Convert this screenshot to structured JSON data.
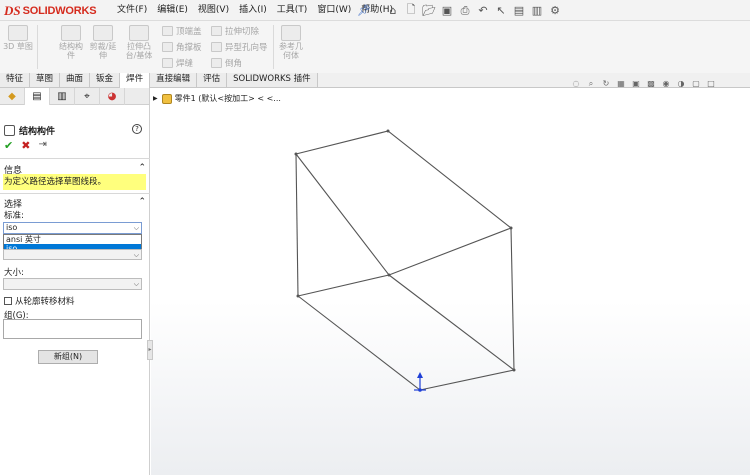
{
  "app": {
    "logo_ds": "DS",
    "logo_name": "SOLIDWORKS"
  },
  "menu": [
    "文件(F)",
    "编辑(E)",
    "视图(V)",
    "插入(I)",
    "工具(T)",
    "窗口(W)",
    "帮助(H)"
  ],
  "ribbon": {
    "sketch_3d": "3D 草图",
    "structural_member": "结构构件",
    "trim_extend": "剪裁/延伸",
    "extruded_boss": "拉伸凸台/基体",
    "end_cap": "顶端盖",
    "gusset": "角撑板",
    "weld_bead": "焊缝",
    "extruded_cut": "拉伸切除",
    "hole_wizard": "异型孔向导",
    "chamfer": "倒角",
    "reference_geometry": "参考几何体"
  },
  "command_tabs": [
    "特征",
    "草图",
    "曲面",
    "钣金",
    "焊件",
    "直接编辑",
    "评估",
    "SOLIDWORKS 插件"
  ],
  "active_tab": "焊件",
  "panel": {
    "title": "结构构件",
    "help": "?",
    "info_header": "信息",
    "info_message": "为定义路径选择草图线段。",
    "selection_header": "选择",
    "standard_label": "标准:",
    "standard_value": "iso",
    "standard_options": [
      "ansi 英寸",
      "iso"
    ],
    "size_label": "大小:",
    "checkbox_label": "从轮廓转移材料",
    "group_label": "组(G):",
    "new_group_button": "新组(N)"
  },
  "tree": {
    "part_label": "零件1 (默认<按加工> < <..."
  }
}
